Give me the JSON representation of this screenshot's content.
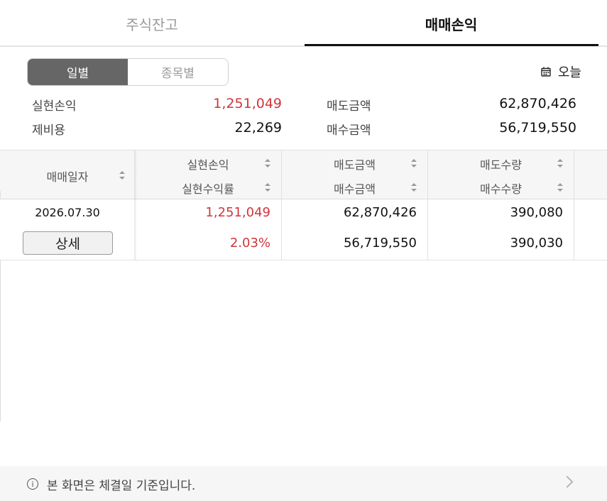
{
  "tabs": [
    {
      "label": "주식잔고",
      "active": false
    },
    {
      "label": "매매손익",
      "active": true
    }
  ],
  "segment": {
    "options": [
      "일별",
      "종목별"
    ],
    "selected": "일별"
  },
  "date_button": {
    "label": "오늘",
    "icon": "calendar-icon"
  },
  "summary": {
    "realized_pl_label": "실현손익",
    "realized_pl_value": "1,251,049",
    "fees_label": "제비용",
    "fees_value": "22,269",
    "sell_amount_label": "매도금액",
    "sell_amount_value": "62,870,426",
    "buy_amount_label": "매수금액",
    "buy_amount_value": "56,719,550"
  },
  "table": {
    "headers": {
      "date": "매매일자",
      "realized_pl": "실현손익",
      "realized_rate": "실현수익률",
      "sell_amount": "매도금액",
      "buy_amount": "매수금액",
      "sell_qty": "매도수량",
      "buy_qty": "매수수량"
    },
    "rows": [
      {
        "date": "2026.07.30",
        "detail_label": "상세",
        "realized_pl": "1,251,049",
        "realized_rate": "2.03%",
        "sell_amount": "62,870,426",
        "buy_amount": "56,719,550",
        "sell_qty": "390,080",
        "buy_qty": "390,030"
      }
    ]
  },
  "notice": {
    "text": "본 화면은 체결일 기준입니다."
  },
  "colors": {
    "profit": "#d0363b",
    "segment_active": "#666666"
  }
}
